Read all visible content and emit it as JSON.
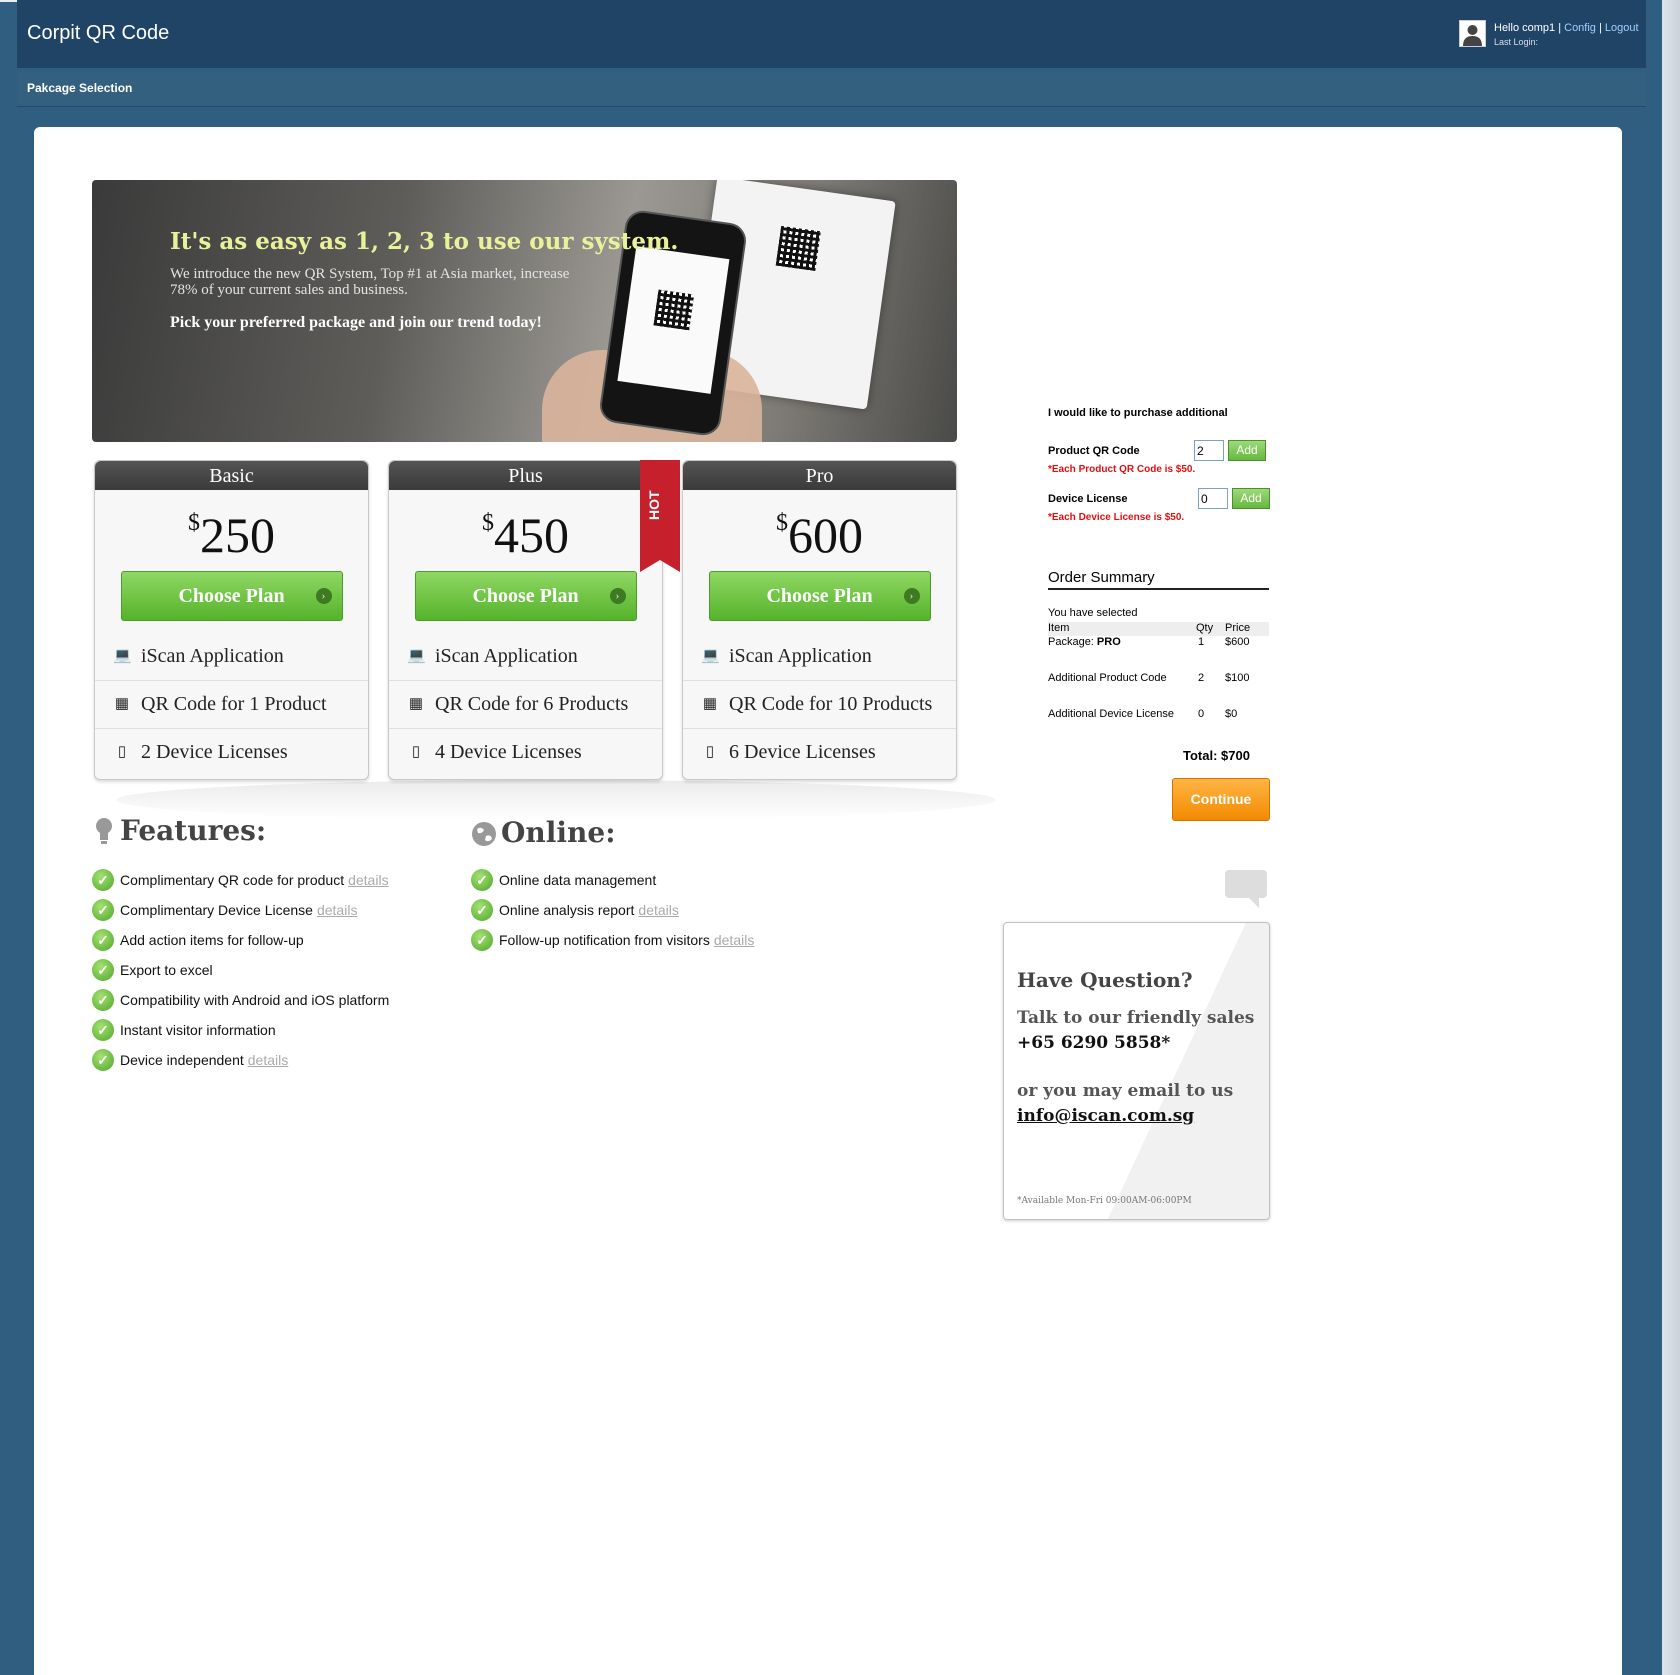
{
  "header": {
    "app_title": "Corpit QR Code",
    "greeting": "Hello comp1",
    "sep1": " | ",
    "config_link": "Config",
    "sep2": " | ",
    "logout_link": "Logout",
    "last_login": "Last Login:"
  },
  "subnav": {
    "title": "Pakcage Selection"
  },
  "banner": {
    "headline": "It's as easy as 1, 2, 3 to use our system.",
    "text": "We introduce the new QR System, Top #1 at Asia market, increase 78% of your current sales and business.",
    "cta": "Pick your preferred package and join our trend today!"
  },
  "plans": [
    {
      "name": "Basic",
      "currency": "$",
      "price": "250",
      "button": "Choose Plan",
      "features": [
        "iScan Application",
        "QR Code for 1 Product",
        "2 Device Licenses"
      ]
    },
    {
      "name": "Plus",
      "currency": "$",
      "price": "450",
      "button": "Choose Plan",
      "ribbon": "HOT",
      "features": [
        "iScan Application",
        "QR Code for 6 Products",
        "4 Device Licenses"
      ]
    },
    {
      "name": "Pro",
      "currency": "$",
      "price": "600",
      "button": "Choose Plan",
      "features": [
        "iScan Application",
        "QR Code for 10 Products",
        "6 Device Licenses"
      ]
    }
  ],
  "features": {
    "title": "Features:",
    "items": [
      {
        "text": "Complimentary QR code for product",
        "link": "details"
      },
      {
        "text": "Complimentary Device License",
        "link": "details"
      },
      {
        "text": "Add action items for follow-up",
        "link": ""
      },
      {
        "text": "Export to excel",
        "link": ""
      },
      {
        "text": "Compatibility with Android and iOS platform",
        "link": ""
      },
      {
        "text": "Instant visitor information",
        "link": ""
      },
      {
        "text": "Device independent",
        "link": "details"
      }
    ]
  },
  "online": {
    "title": "Online:",
    "items": [
      {
        "text": "Online data management",
        "link": ""
      },
      {
        "text": "Online analysis report",
        "link": "details"
      },
      {
        "text": "Follow-up notification from visitors",
        "link": "details"
      }
    ]
  },
  "additional": {
    "title": "I would like to purchase additional",
    "product_label": "Product QR Code",
    "product_value": "2",
    "product_note": "*Each Product QR Code is $50.",
    "device_label": "Device License",
    "device_value": "0",
    "device_note": "*Each Device License is $50.",
    "add_label": "Add"
  },
  "order_summary": {
    "title": "Order Summary",
    "selected": "You have selected",
    "headers": {
      "item": "Item",
      "qty": "Qty",
      "price": "Price"
    },
    "package_prefix": "Package: ",
    "package_name": "PRO",
    "package_qty": "1",
    "package_price": "$600",
    "rows": [
      {
        "item": "Additional Product Code",
        "qty": "2",
        "price": "$100"
      },
      {
        "item": "Additional Device License",
        "qty": "0",
        "price": "$0"
      }
    ],
    "total": "Total: $700",
    "continue": "Continue"
  },
  "question": {
    "title": "Have Question?",
    "line1": "Talk to our friendly sales",
    "phone": "+65 6290 5858*",
    "line2": "or you may email to us",
    "email": "info@iscan.com.sg",
    "note": "*Available Mon-Fri 09:00AM-06:00PM"
  },
  "icons": {
    "laptop": "laptop-icon",
    "qr": "qr-card-icon",
    "device": "tablet-icon",
    "check": "check-icon",
    "bulb": "lightbulb-icon",
    "globe": "globe-icon"
  },
  "colors": {
    "header_bg": "#1f4465",
    "page_bg": "#2f5e80",
    "green": "#56b32b",
    "orange": "#f28a00",
    "ribbon": "#c5202b",
    "banner_headline": "#e9f29a"
  }
}
